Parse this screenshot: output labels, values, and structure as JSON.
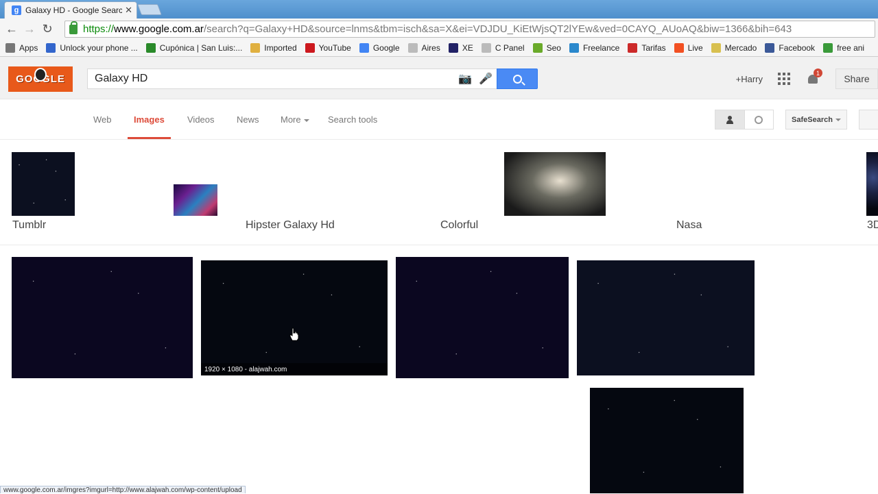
{
  "browser": {
    "tab_title": "Galaxy HD - Google Searc",
    "tab_favicon": "g",
    "url_scheme": "https://",
    "url_host": "www.google.com.ar",
    "url_rest": "/search?q=Galaxy+HD&source=lnms&tbm=isch&sa=X&ei=VDJDU_KiEtWjsQT2lYEw&ved=0CAYQ_AUoAQ&biw=1366&bih=643",
    "bookmarks": [
      {
        "label": "Apps",
        "icon": "apps-icon",
        "color": "#777777"
      },
      {
        "label": "Unlock your phone ...",
        "icon": "page-icon",
        "color": "#3366cc"
      },
      {
        "label": "Cupónica | San Luis:...",
        "icon": "cuponica-icon",
        "color": "#2a8a2a"
      },
      {
        "label": "Imported",
        "icon": "folder-icon",
        "color": "#e0b040"
      },
      {
        "label": "YouTube",
        "icon": "youtube-icon",
        "color": "#cc181e"
      },
      {
        "label": "Google",
        "icon": "google-icon",
        "color": "#4285f4"
      },
      {
        "label": "Aires",
        "icon": "page-icon",
        "color": "#bbbbbb"
      },
      {
        "label": "XE",
        "icon": "xe-icon",
        "color": "#222266"
      },
      {
        "label": "C Panel",
        "icon": "page-icon",
        "color": "#bbbbbb"
      },
      {
        "label": "Seo",
        "icon": "seo-icon",
        "color": "#6aaa2a"
      },
      {
        "label": "Freelance",
        "icon": "freelance-icon",
        "color": "#2a88cc"
      },
      {
        "label": "Tarifas",
        "icon": "tarifas-icon",
        "color": "#cc2a2a"
      },
      {
        "label": "Live",
        "icon": "windows-icon",
        "color": "#f25022"
      },
      {
        "label": "Mercado",
        "icon": "mercado-icon",
        "color": "#d8c050"
      },
      {
        "label": "Facebook",
        "icon": "facebook-icon",
        "color": "#3b5998"
      },
      {
        "label": "free ani",
        "icon": "arrow-icon",
        "color": "#3a9a3a"
      }
    ]
  },
  "header": {
    "logo_text": "GOOGLE",
    "search_query": "Galaxy HD",
    "user_name": "+Harry",
    "notification_count": "1",
    "share_label": "Share"
  },
  "nav": {
    "tabs": [
      "Web",
      "Images",
      "Videos",
      "News",
      "More",
      "Search tools"
    ],
    "active": "Images",
    "safesearch_label": "SafeSearch"
  },
  "related": [
    {
      "label": "Tumblr"
    },
    {
      "label": "Hipster Galaxy Hd"
    },
    {
      "label": "Colorful"
    },
    {
      "label": "Nasa"
    },
    {
      "label": "3D"
    }
  ],
  "results": {
    "hover_caption": "1920 × 1080 - alajwah.com"
  },
  "status_bar": "www.google.com.ar/imgres?imgurl=http://www.alajwah.com/wp-content/upload"
}
